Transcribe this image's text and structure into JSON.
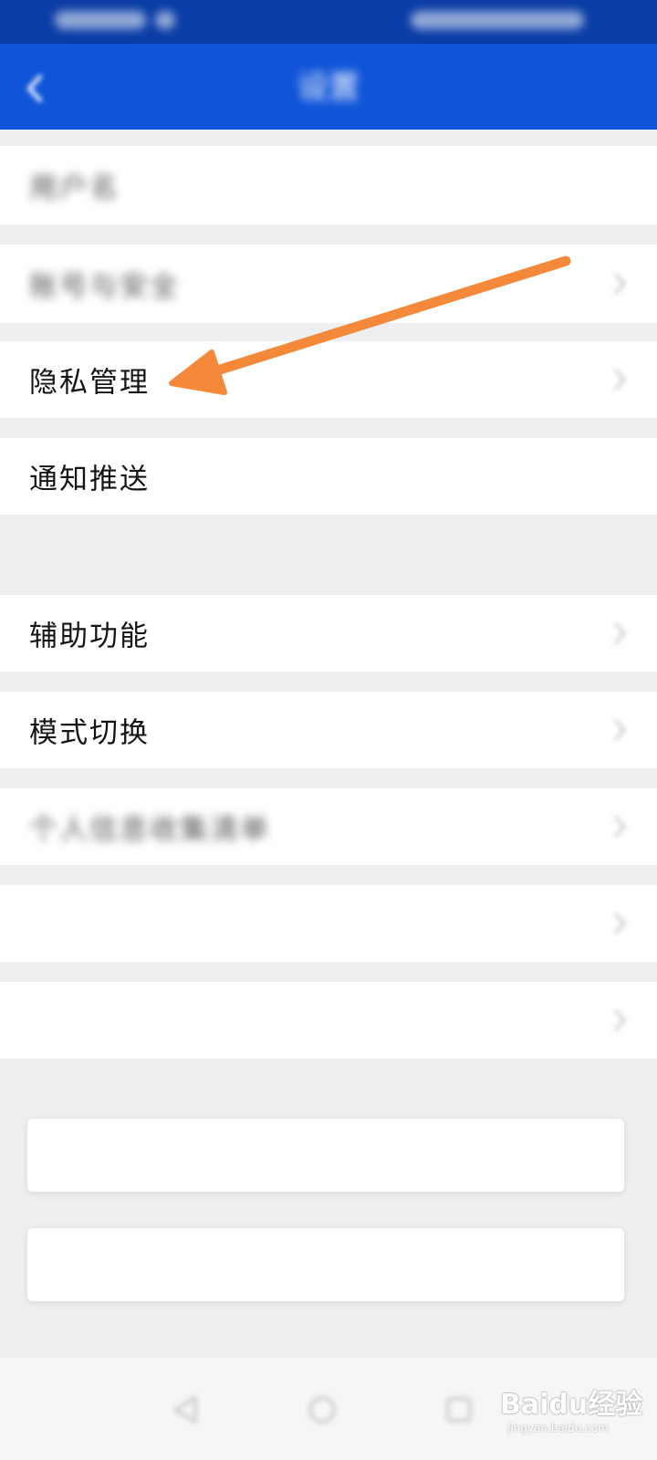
{
  "header": {
    "title": "设置"
  },
  "rows": [
    {
      "label": "用户名",
      "value": "",
      "blurred": true
    },
    {
      "label": "账号与安全",
      "value": "",
      "blurred": true
    },
    {
      "label": "隐私管理",
      "value": "",
      "blurred": false
    },
    {
      "label": "通知推送",
      "value": "",
      "blurred": false
    },
    {
      "label": "辅助功能",
      "value": "",
      "blurred": false
    },
    {
      "label": "模式切换",
      "value": "",
      "blurred": false
    },
    {
      "label": "个人信息收集清单",
      "value": "",
      "blurred": true
    },
    {
      "label": "",
      "value": "",
      "blurred": true
    },
    {
      "label": "",
      "value": "",
      "blurred": true
    }
  ],
  "section_hint": "",
  "buttons": {
    "primary": "",
    "secondary": ""
  },
  "watermark": {
    "brand": "Baidu经验",
    "site": "jingyan.baidu.com"
  },
  "colors": {
    "statusbar": "#0b3da6",
    "appbar": "#1055d8",
    "annotation_arrow": "#f4893a"
  }
}
